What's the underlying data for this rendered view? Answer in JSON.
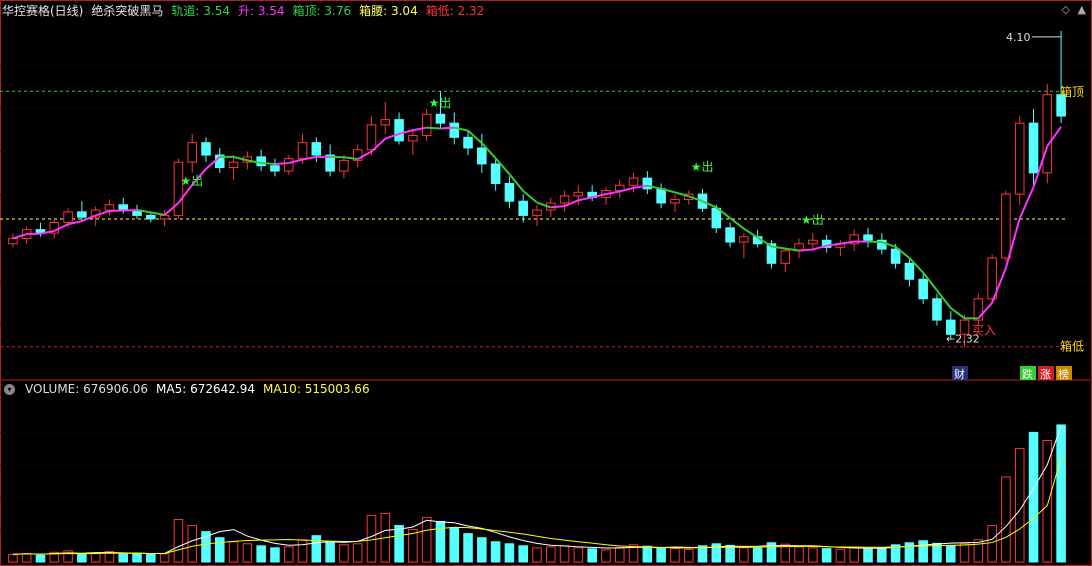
{
  "header": {
    "title": "华控赛格(日线)",
    "indicator_name": "绝杀突破黑马",
    "params": [
      {
        "label": "轨道",
        "value": "3.54",
        "color": "#2fd64a"
      },
      {
        "label": "升",
        "value": "3.54",
        "color": "#ff33ff"
      },
      {
        "label": "箱顶",
        "value": "3.76",
        "color": "#2fd64a"
      },
      {
        "label": "箱腰",
        "value": "3.04",
        "color": "#ffff66"
      },
      {
        "label": "箱低",
        "value": "2.32",
        "color": "#ff3333"
      }
    ]
  },
  "volume_header": {
    "label": "VOLUME",
    "value": "676906.06",
    "ma5_label": "MA5",
    "ma5_value": "672642.94",
    "ma10_label": "MA10",
    "ma10_value": "515003.66"
  },
  "annotations": {
    "high_marker": "4.10",
    "low_marker": "2.32",
    "box_top_label": "箱顶",
    "box_low_label": "箱低",
    "buy_label": "买入",
    "sell_label": "出",
    "finance_badge": "财",
    "badges": [
      "跌",
      "涨",
      "榜"
    ]
  },
  "colors": {
    "up": "#ff3333",
    "down": "#54ffff",
    "box_top": "#33cc33",
    "box_mid": "#ffff66",
    "box_low": "#cc2222",
    "track_down": "#33cc33",
    "track_up": "#ff33ff",
    "ma5": "#ffffff",
    "ma10": "#ffff00"
  },
  "chart_data": {
    "type": "candlestick",
    "price_range": [
      2.2,
      4.15
    ],
    "levels": {
      "box_top": 3.76,
      "box_mid": 3.04,
      "box_low": 2.32,
      "high": 4.1,
      "low": 2.32
    },
    "candles": [
      [
        2.9,
        2.96,
        2.88,
        2.93
      ],
      [
        2.93,
        3.0,
        2.9,
        2.98
      ],
      [
        2.98,
        3.02,
        2.94,
        2.96
      ],
      [
        2.96,
        3.04,
        2.93,
        3.02
      ],
      [
        3.02,
        3.1,
        2.99,
        3.08
      ],
      [
        3.08,
        3.14,
        3.03,
        3.05
      ],
      [
        3.05,
        3.11,
        3.0,
        3.09
      ],
      [
        3.09,
        3.15,
        3.06,
        3.12
      ],
      [
        3.12,
        3.16,
        3.07,
        3.09
      ],
      [
        3.09,
        3.12,
        3.04,
        3.06
      ],
      [
        3.06,
        3.08,
        3.02,
        3.04
      ],
      [
        3.04,
        3.09,
        3.0,
        3.06
      ],
      [
        3.06,
        3.38,
        3.04,
        3.36
      ],
      [
        3.36,
        3.52,
        3.3,
        3.47
      ],
      [
        3.47,
        3.5,
        3.36,
        3.4
      ],
      [
        3.4,
        3.44,
        3.3,
        3.33
      ],
      [
        3.33,
        3.4,
        3.26,
        3.36
      ],
      [
        3.36,
        3.42,
        3.32,
        3.39
      ],
      [
        3.39,
        3.43,
        3.31,
        3.34
      ],
      [
        3.34,
        3.38,
        3.28,
        3.31
      ],
      [
        3.31,
        3.4,
        3.29,
        3.38
      ],
      [
        3.38,
        3.52,
        3.35,
        3.47
      ],
      [
        3.47,
        3.5,
        3.36,
        3.4
      ],
      [
        3.4,
        3.46,
        3.28,
        3.31
      ],
      [
        3.31,
        3.4,
        3.27,
        3.37
      ],
      [
        3.37,
        3.46,
        3.33,
        3.43
      ],
      [
        3.43,
        3.62,
        3.4,
        3.57
      ],
      [
        3.57,
        3.7,
        3.52,
        3.6
      ],
      [
        3.6,
        3.64,
        3.46,
        3.48
      ],
      [
        3.48,
        3.55,
        3.4,
        3.51
      ],
      [
        3.51,
        3.66,
        3.48,
        3.63
      ],
      [
        3.63,
        3.76,
        3.55,
        3.58
      ],
      [
        3.58,
        3.64,
        3.46,
        3.5
      ],
      [
        3.5,
        3.54,
        3.4,
        3.44
      ],
      [
        3.44,
        3.52,
        3.3,
        3.35
      ],
      [
        3.35,
        3.38,
        3.2,
        3.24
      ],
      [
        3.24,
        3.28,
        3.1,
        3.14
      ],
      [
        3.14,
        3.18,
        3.02,
        3.06
      ],
      [
        3.06,
        3.12,
        3.0,
        3.09
      ],
      [
        3.09,
        3.16,
        3.05,
        3.13
      ],
      [
        3.13,
        3.2,
        3.08,
        3.17
      ],
      [
        3.17,
        3.23,
        3.12,
        3.19
      ],
      [
        3.19,
        3.23,
        3.14,
        3.16
      ],
      [
        3.16,
        3.22,
        3.12,
        3.2
      ],
      [
        3.2,
        3.26,
        3.16,
        3.23
      ],
      [
        3.23,
        3.3,
        3.19,
        3.27
      ],
      [
        3.27,
        3.31,
        3.18,
        3.21
      ],
      [
        3.21,
        3.24,
        3.1,
        3.13
      ],
      [
        3.13,
        3.18,
        3.08,
        3.15
      ],
      [
        3.15,
        3.2,
        3.12,
        3.18
      ],
      [
        3.18,
        3.21,
        3.08,
        3.1
      ],
      [
        3.1,
        3.12,
        2.96,
        2.99
      ],
      [
        2.99,
        3.02,
        2.88,
        2.91
      ],
      [
        2.91,
        2.96,
        2.82,
        2.94
      ],
      [
        2.94,
        2.98,
        2.88,
        2.9
      ],
      [
        2.9,
        2.92,
        2.76,
        2.79
      ],
      [
        2.79,
        2.88,
        2.74,
        2.86
      ],
      [
        2.86,
        2.93,
        2.82,
        2.9
      ],
      [
        2.9,
        2.96,
        2.86,
        2.92
      ],
      [
        2.92,
        2.95,
        2.85,
        2.88
      ],
      [
        2.88,
        2.92,
        2.83,
        2.9
      ],
      [
        2.9,
        2.98,
        2.86,
        2.95
      ],
      [
        2.95,
        2.99,
        2.88,
        2.92
      ],
      [
        2.92,
        2.96,
        2.84,
        2.87
      ],
      [
        2.87,
        2.9,
        2.76,
        2.79
      ],
      [
        2.79,
        2.82,
        2.66,
        2.7
      ],
      [
        2.7,
        2.74,
        2.56,
        2.59
      ],
      [
        2.59,
        2.62,
        2.44,
        2.47
      ],
      [
        2.47,
        2.52,
        2.36,
        2.39
      ],
      [
        2.39,
        2.5,
        2.32,
        2.47
      ],
      [
        2.47,
        2.62,
        2.44,
        2.59
      ],
      [
        2.59,
        2.84,
        2.56,
        2.82
      ],
      [
        2.82,
        3.2,
        2.8,
        3.18
      ],
      [
        3.18,
        3.62,
        3.12,
        3.58
      ],
      [
        3.58,
        3.66,
        3.22,
        3.3
      ],
      [
        3.3,
        3.8,
        3.24,
        3.74
      ],
      [
        3.74,
        4.1,
        3.58,
        3.62
      ]
    ],
    "volume": {
      "range_max": 800000,
      "values": [
        36000,
        42000,
        33000,
        48000,
        55000,
        38000,
        41000,
        52000,
        39000,
        44000,
        37000,
        40000,
        210000,
        180000,
        150000,
        120000,
        100000,
        90000,
        80000,
        70000,
        75000,
        110000,
        130000,
        95000,
        85000,
        90000,
        230000,
        240000,
        180000,
        160000,
        220000,
        200000,
        170000,
        140000,
        120000,
        100000,
        90000,
        80000,
        70000,
        75000,
        80000,
        70000,
        65000,
        60000,
        72000,
        85000,
        78000,
        70000,
        66000,
        62000,
        80000,
        90000,
        82000,
        70000,
        68000,
        95000,
        88000,
        75000,
        70000,
        66000,
        63000,
        72000,
        68000,
        70000,
        85000,
        95000,
        105000,
        92000,
        82000,
        90000,
        110000,
        180000,
        420000,
        560000,
        640000,
        600000,
        676906
      ],
      "ma5": [
        38000,
        40000,
        38000,
        42000,
        45000,
        43000,
        46000,
        47000,
        45000,
        43000,
        42000,
        42000,
        76000,
        105000,
        126000,
        150000,
        160000,
        128000,
        108000,
        92000,
        83000,
        85000,
        95000,
        100000,
        97000,
        102000,
        126000,
        156000,
        162000,
        173000,
        206000,
        198000,
        194000,
        178000,
        166000,
        146000,
        124000,
        106000,
        92000,
        83000,
        79000,
        75000,
        72000,
        69000,
        69000,
        72000,
        72000,
        71000,
        74000,
        72000,
        71000,
        75000,
        78000,
        77000,
        78000,
        81000,
        81000,
        80000,
        80000,
        76000,
        72000,
        69000,
        68000,
        68000,
        72000,
        78000,
        84000,
        89000,
        93000,
        95000,
        97000,
        112000,
        175000,
        256000,
        363000,
        480000,
        672643
      ],
      "ma10": [
        38000,
        40000,
        39000,
        40000,
        42000,
        41000,
        42000,
        44000,
        43000,
        43000,
        42000,
        42000,
        60000,
        78000,
        89000,
        96000,
        102000,
        106000,
        108000,
        109000,
        111000,
        108000,
        106000,
        103000,
        101000,
        102000,
        109000,
        120000,
        130000,
        141000,
        157000,
        166000,
        171000,
        170000,
        163000,
        155000,
        147000,
        138000,
        127000,
        116000,
        108000,
        100000,
        93000,
        85000,
        79000,
        76000,
        74000,
        72000,
        70000,
        69000,
        71000,
        72000,
        73000,
        73000,
        73000,
        75000,
        76000,
        77000,
        77000,
        75000,
        74000,
        74000,
        73000,
        73000,
        75000,
        77000,
        79000,
        81000,
        82000,
        84000,
        88000,
        96000,
        122000,
        163000,
        216000,
        279000,
        515004
      ]
    }
  }
}
